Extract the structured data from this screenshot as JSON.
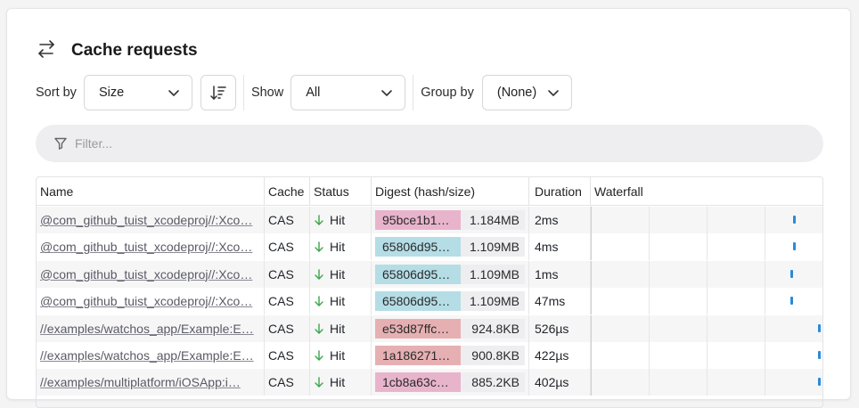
{
  "header": {
    "title": "Cache requests",
    "icon": "arrows-exchange-icon"
  },
  "controls": {
    "sort_by_label": "Sort by",
    "sort_value": "Size",
    "show_label": "Show",
    "show_value": "All",
    "group_by_label": "Group by",
    "group_value": "(None)"
  },
  "filter": {
    "placeholder": "Filter..."
  },
  "table": {
    "columns": [
      "Name",
      "Cache",
      "Status",
      "Digest (hash/size)",
      "Duration",
      "Waterfall"
    ],
    "rows": [
      {
        "name": "@com_github_tuist_xcodeproj//:Xco…",
        "cache": "CAS",
        "status": "Hit",
        "hash": "95bce1b1…",
        "size": "1.184MB",
        "duration": "2ms",
        "hash_color": "#e8b4cc",
        "wf": 0.88
      },
      {
        "name": "@com_github_tuist_xcodeproj//:Xco…",
        "cache": "CAS",
        "status": "Hit",
        "hash": "65806d95…",
        "size": "1.109MB",
        "duration": "4ms",
        "hash_color": "#b5dde6",
        "wf": 0.88
      },
      {
        "name": "@com_github_tuist_xcodeproj//:Xco…",
        "cache": "CAS",
        "status": "Hit",
        "hash": "65806d95…",
        "size": "1.109MB",
        "duration": "1ms",
        "hash_color": "#b5dde6",
        "wf": 0.87
      },
      {
        "name": "@com_github_tuist_xcodeproj//:Xco…",
        "cache": "CAS",
        "status": "Hit",
        "hash": "65806d95…",
        "size": "1.109MB",
        "duration": "47ms",
        "hash_color": "#b5dde6",
        "wf": 0.87
      },
      {
        "name": "//examples/watchos_app/Example:E…",
        "cache": "CAS",
        "status": "Hit",
        "hash": "e53d87ffc…",
        "size": "924.8KB",
        "duration": "526µs",
        "hash_color": "#e6b0b3",
        "wf": 0.99
      },
      {
        "name": "//examples/watchos_app/Example:E…",
        "cache": "CAS",
        "status": "Hit",
        "hash": "1a186271…",
        "size": "900.8KB",
        "duration": "422µs",
        "hash_color": "#e6b0b3",
        "wf": 0.99
      },
      {
        "name": "//examples/multiplatform/iOSApp:i…",
        "cache": "CAS",
        "status": "Hit",
        "hash": "1cb8a63c…",
        "size": "885.2KB",
        "duration": "402µs",
        "hash_color": "#e8b4cc",
        "wf": 0.99
      }
    ]
  }
}
